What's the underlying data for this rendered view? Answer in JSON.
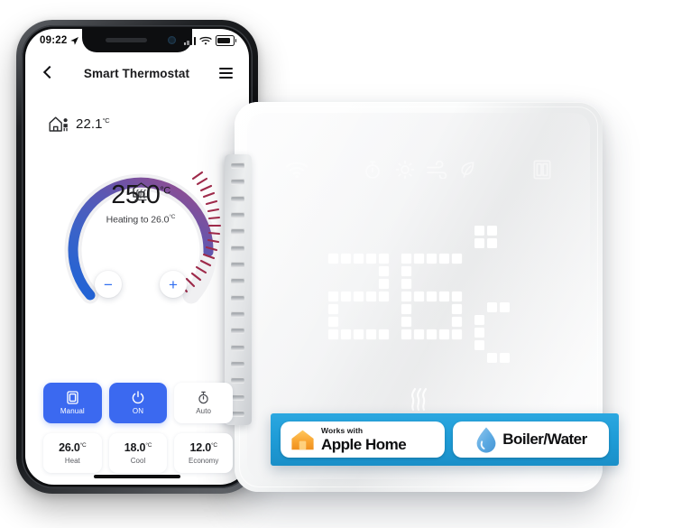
{
  "phone": {
    "status_bar": {
      "time": "09:22",
      "location_icon": "location-arrow-icon",
      "signal_icon": "cellular-signal-icon",
      "wifi_icon": "wifi-icon",
      "battery_icon": "battery-icon"
    },
    "header": {
      "back_icon": "chevron-left-icon",
      "title": "Smart Thermostat",
      "menu_icon": "hamburger-menu-icon"
    },
    "ambient": {
      "icon": "home-occupancy-icon",
      "value": "22.1",
      "unit": "°C"
    },
    "dial": {
      "home_icon": "home-icon",
      "setpoint": "25.0",
      "setpoint_unit": "°C",
      "status_text": "Heating to 26.0",
      "status_unit": "°C",
      "heating_icon": "radiator-heat-icon",
      "decrease_label": "−",
      "increase_label": "+",
      "gradient_start": "#2F6BD8",
      "gradient_end": "#7E4F9C",
      "tick_color": "#9E2A4A"
    },
    "modes": [
      {
        "label": "Manual",
        "icon": "document-mode-icon",
        "active": true
      },
      {
        "label": "ON",
        "icon": "power-icon",
        "active": true
      },
      {
        "label": "Auto",
        "icon": "timer-icon",
        "active": false
      }
    ],
    "presets": [
      {
        "value": "26.0",
        "unit": "°C",
        "label": "Heat"
      },
      {
        "value": "18.0",
        "unit": "°C",
        "label": "Cool"
      },
      {
        "value": "12.0",
        "unit": "°C",
        "label": "Economy"
      }
    ],
    "accent_color": "#3B69F0",
    "home_indicator": "home-indicator-bar"
  },
  "device": {
    "status_icons": [
      "wifi-icon",
      "timer-icon",
      "sun-icon",
      "wind-icon",
      "leaf-eco-icon",
      "open-window-icon"
    ],
    "display_temperature": "26",
    "display_unit": "°C",
    "heat_icon": "heat-waves-icon",
    "vent_strip": "vent-slots"
  },
  "banner": {
    "background_color": "#1E9BD6",
    "apple_badge": {
      "icon": "apple-home-house-icon",
      "small_text": "Works with",
      "large_text": "Apple Home"
    },
    "boiler_badge": {
      "icon": "water-drop-icon",
      "text": "Boiler/Water"
    }
  }
}
